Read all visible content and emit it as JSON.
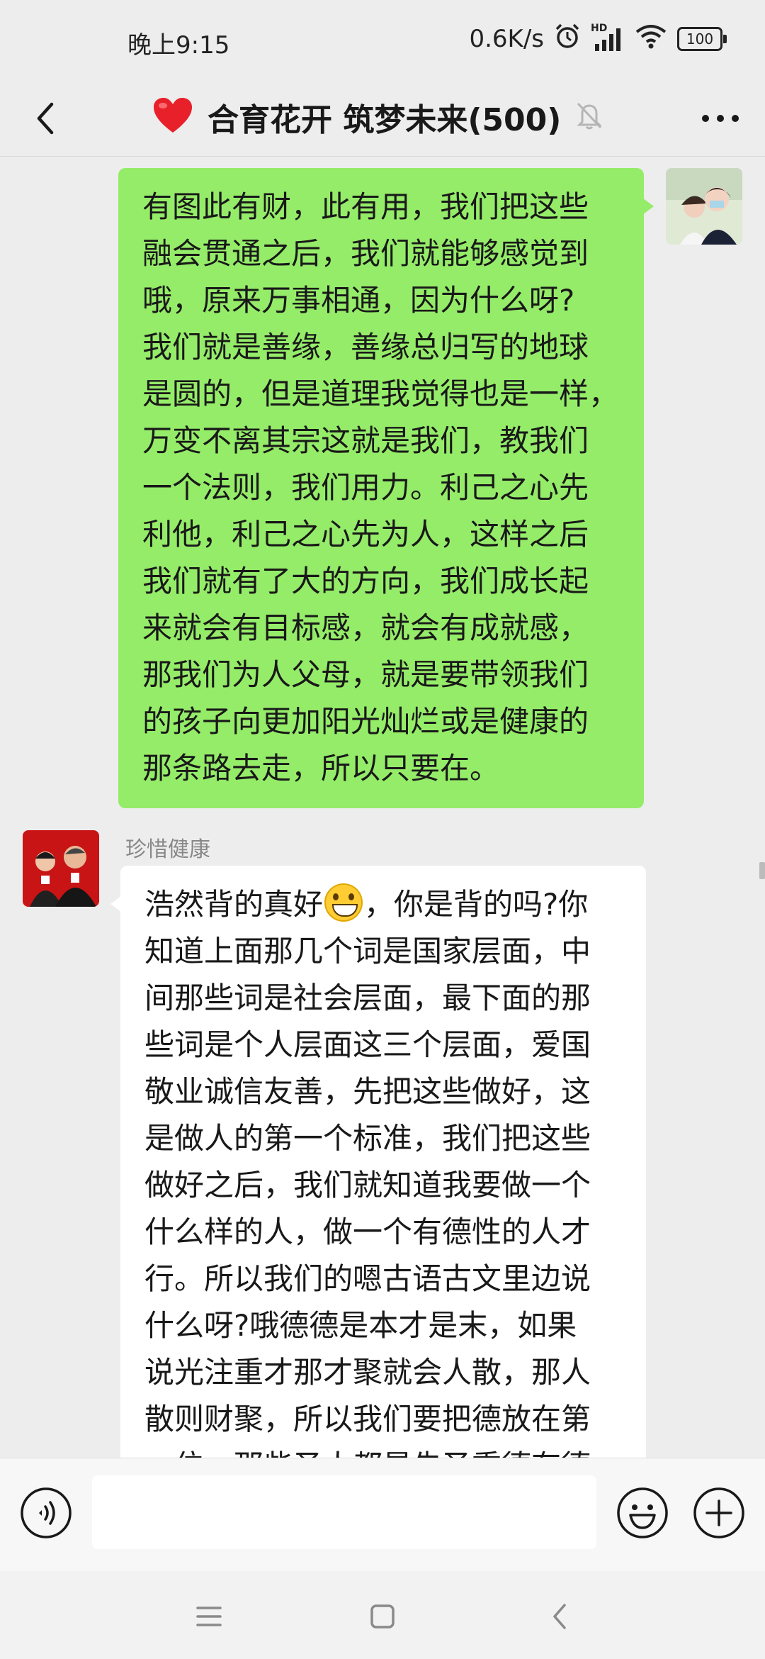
{
  "status_bar": {
    "time": "晚上9:15",
    "network_speed": "0.6K/s",
    "network_type": "HD",
    "battery_level": "100",
    "icons": [
      "alarm-icon",
      "signal-icon",
      "wifi-icon",
      "battery-icon"
    ]
  },
  "header": {
    "title_emoji": "❤️",
    "title": "合育花开 筑梦未来(500)",
    "icons": [
      "back-arrow-icon",
      "heart-icon",
      "mute-bell-icon",
      "more-dots-icon"
    ]
  },
  "messages": [
    {
      "side": "right",
      "sender": "",
      "lines": [
        "有图此有财，此有用，我们把这些",
        "融会贯通之后，我们就能够感觉到",
        "哦，原来万事相通，因为什么呀?",
        "我们就是善缘，善缘总归写的地球",
        "是圆的，但是道理我觉得也是一样，",
        "万变不离其宗这就是我们，教我们",
        "一个法则，我们用力。利己之心先",
        "利他，利己之心先为人，这样之后",
        "我们就有了大的方向，我们成长起",
        "来就会有目标感，就会有成就感，",
        "那我们为人父母，就是要带领我们",
        "的孩子向更加阳光灿烂或是健康的",
        "那条路去走，所以只要在。"
      ]
    },
    {
      "side": "left",
      "sender": "珍惜健康",
      "first_line_before_emoji": "浩然背的真好",
      "emoji": "grinning-face",
      "first_line_after_emoji": "，你是背的吗?你",
      "lines": [
        "知道上面那几个词是国家层面，中",
        "间那些词是社会层面，最下面的那",
        "些词是个人层面这三个层面，爱国",
        "敬业诚信友善，先把这些做好，这",
        "是做人的第一个标准，我们把这些",
        "做好之后，我们就知道我要做一个",
        "什么样的人，做一个有德性的人才",
        "行。所以我们的嗯古语古文里边说",
        "什么呀?哦德德是本才是末，如果",
        "说光注重才那才聚就会人散，那人",
        "散则财聚，所以我们要把德放在第",
        "一位，那些圣人都是先圣重德有德"
      ]
    }
  ],
  "input_bar": {
    "placeholder": "",
    "icons": [
      "voice-icon",
      "emoji-icon",
      "plus-icon"
    ]
  },
  "system_nav": {
    "icons": [
      "menu-icon",
      "home-square-icon",
      "back-chevron-icon"
    ]
  }
}
